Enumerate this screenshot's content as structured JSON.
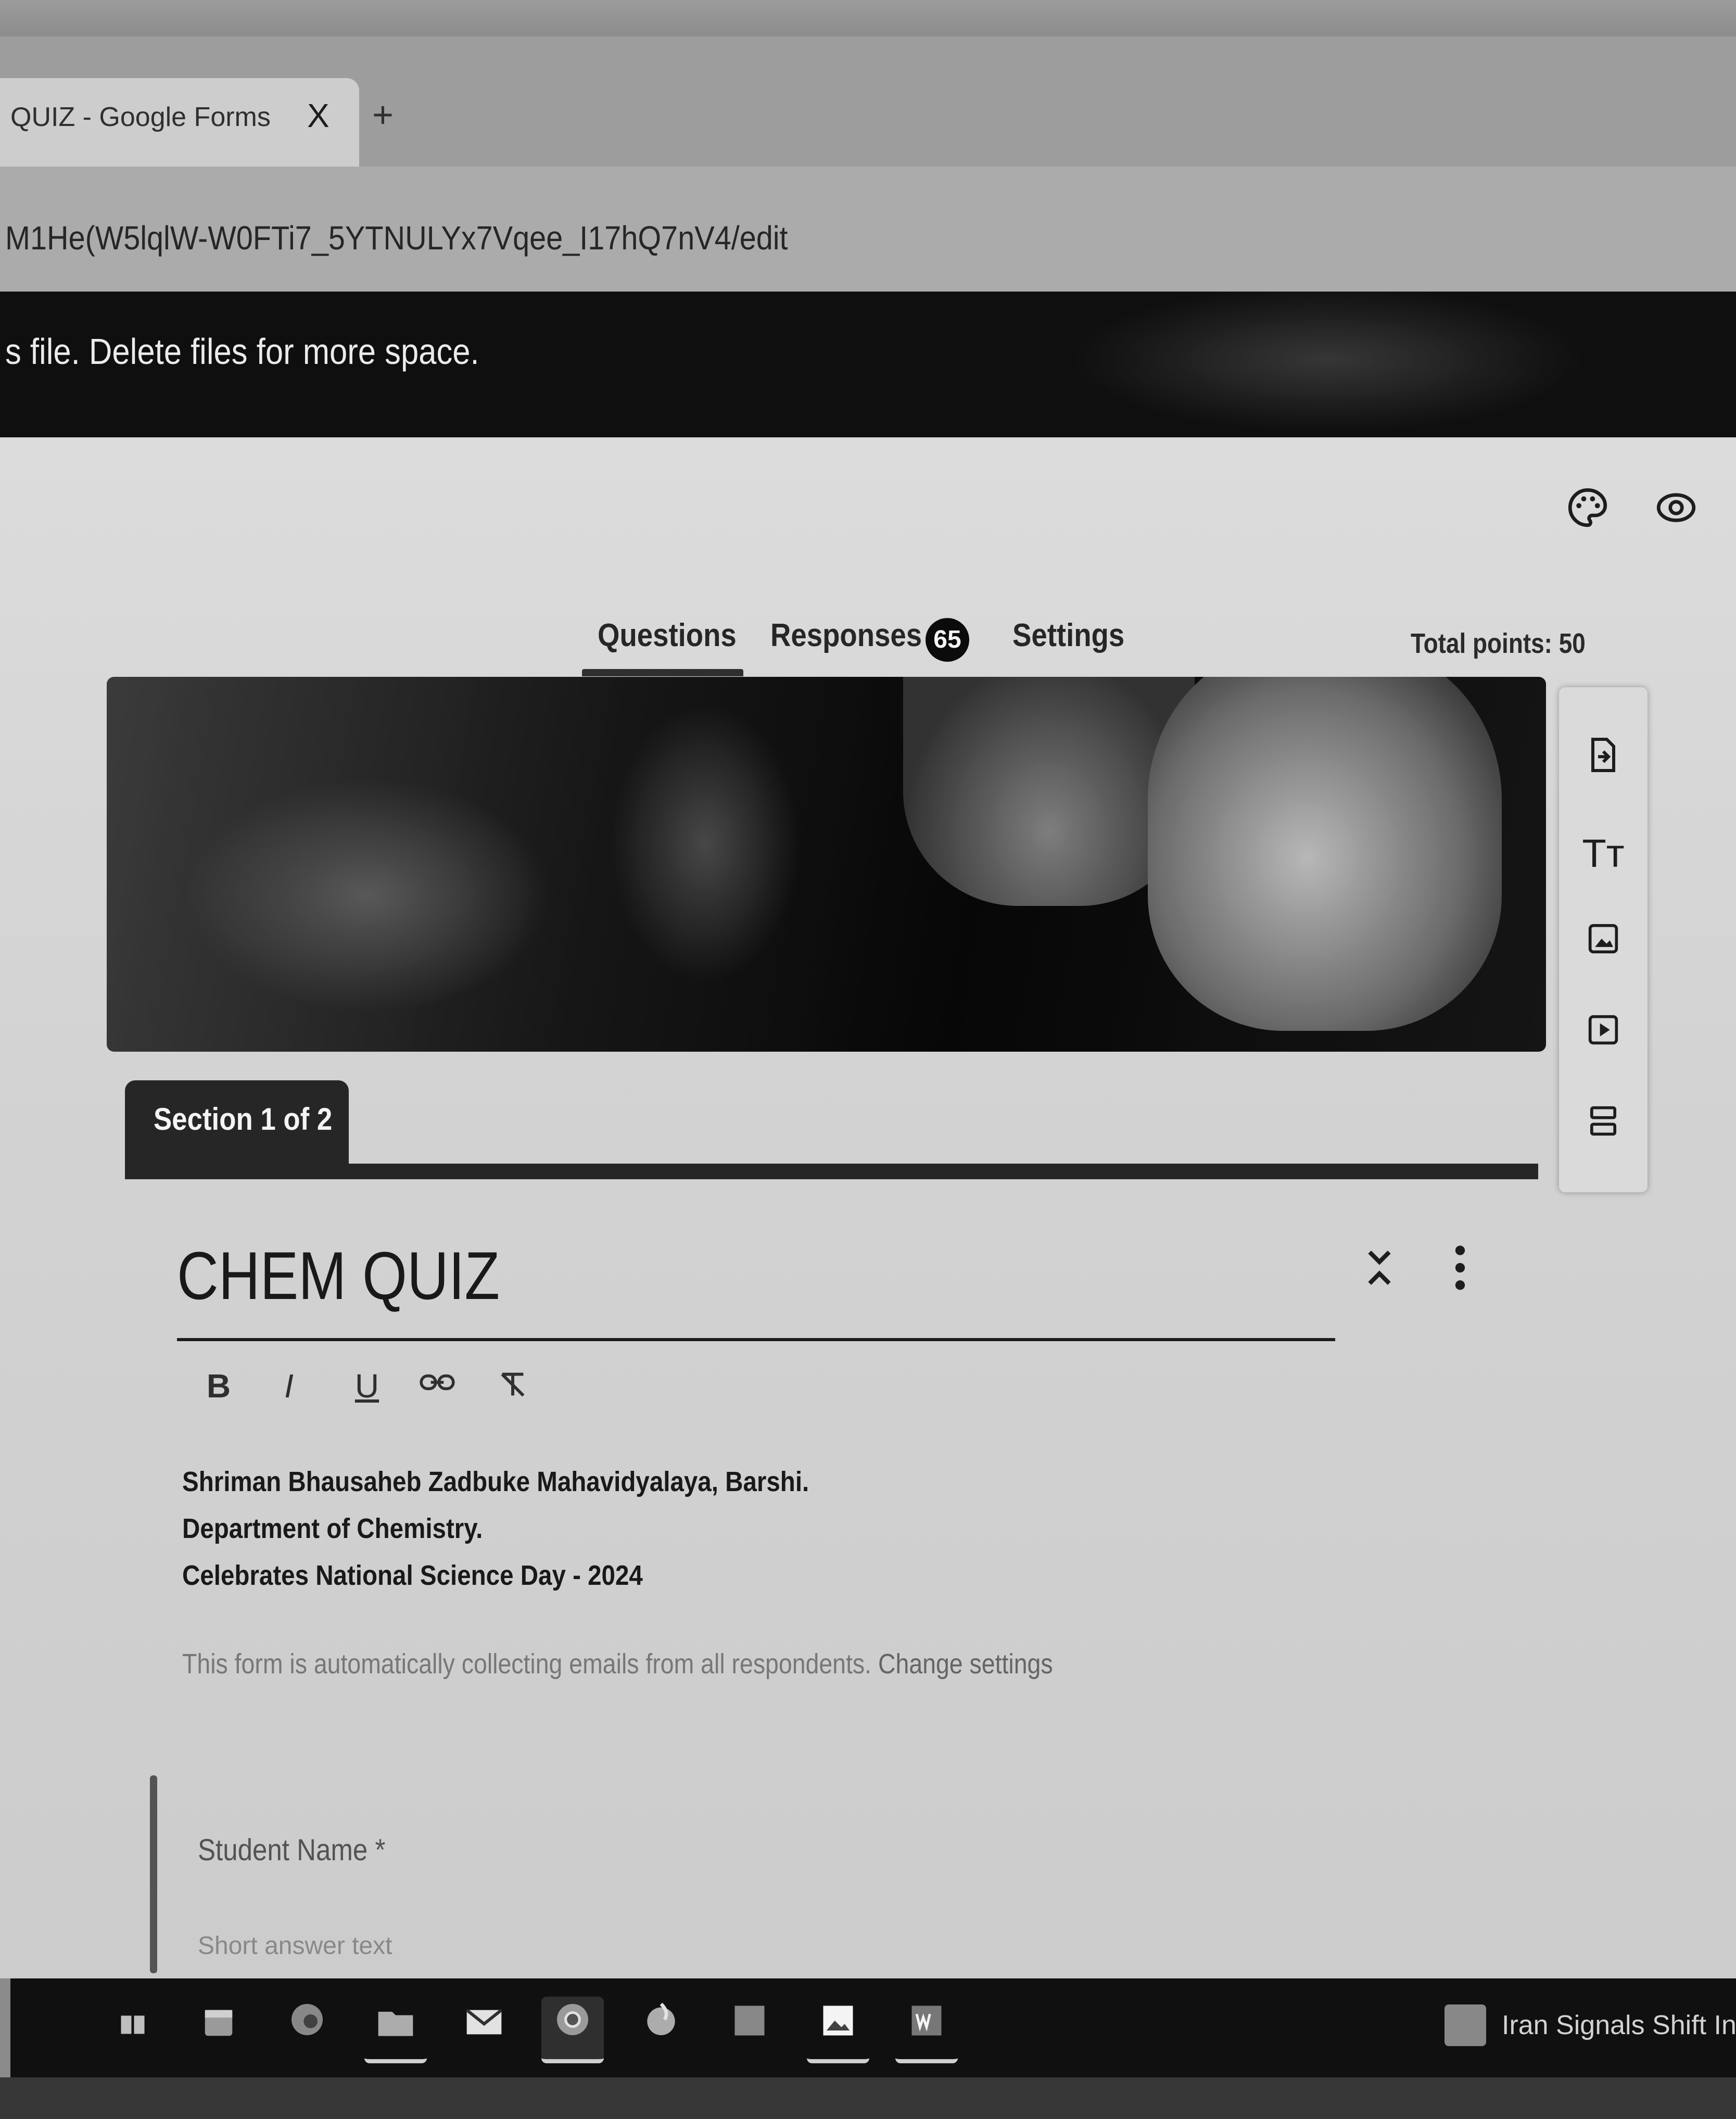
{
  "browser": {
    "tab_title": "QUIZ - Google Forms",
    "tab_close": "X",
    "new_tab": "+",
    "url": "M1He(W5lqlW-W0FTi7_5YTNULYx7Vqee_I17hQ7nV4/edit"
  },
  "banner": {
    "text": "s file. Delete files for more space."
  },
  "header": {
    "tabs": {
      "questions": "Questions",
      "responses": "Responses",
      "responses_count": "65",
      "settings": "Settings"
    },
    "total_points": "Total points: 50",
    "icons": [
      "palette-icon",
      "preview-icon"
    ]
  },
  "toolbar": {
    "icons": [
      "import-questions-icon",
      "add-title-icon",
      "add-image-icon",
      "add-video-icon",
      "add-section-icon"
    ],
    "title_glyph": "Tт"
  },
  "section": {
    "label": "Section 1 of 2"
  },
  "form": {
    "title": "CHEM QUIZ",
    "format_buttons": [
      "B",
      "I",
      "U"
    ],
    "description": [
      "Shriman Bhausaheb Zadbuke Mahavidyalaya, Barshi.",
      "Department of Chemistry.",
      "Celebrates National Science Day - 2024"
    ],
    "email_note": "This form is automatically collecting emails from all respondents.",
    "email_link": "Change settings"
  },
  "question": {
    "label": "Student Name *",
    "placeholder": "Short answer text"
  },
  "taskbar": {
    "news": "Iran Signals Shift In I"
  }
}
